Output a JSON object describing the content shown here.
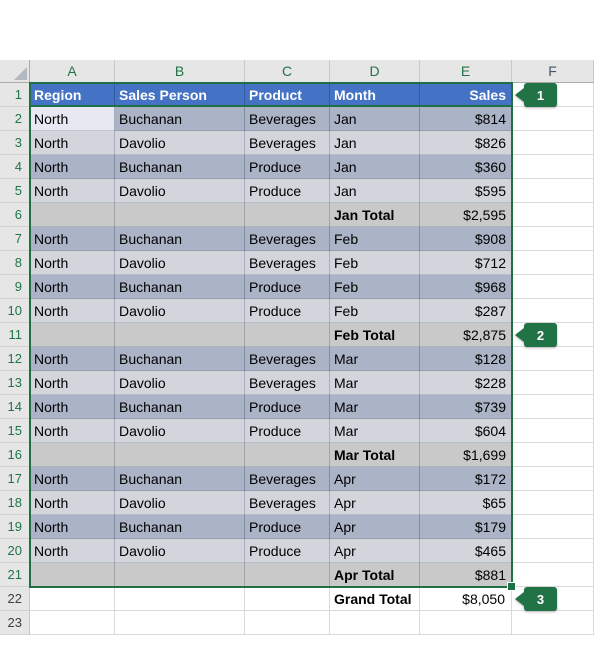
{
  "app": "excel-worksheet-subtotals",
  "column_letters": [
    "A",
    "B",
    "C",
    "D",
    "E",
    "F"
  ],
  "table": {
    "rows": [
      {
        "num": "1",
        "type": "header",
        "cells": [
          "Region",
          "Sales Person",
          "Product",
          "Month",
          "Sales"
        ]
      },
      {
        "num": "2",
        "type": "dark",
        "active": true,
        "cells": [
          "North",
          "Buchanan",
          "Beverages",
          "Jan",
          "$814"
        ]
      },
      {
        "num": "3",
        "type": "light",
        "cells": [
          "North",
          "Davolio",
          "Beverages",
          "Jan",
          "$826"
        ]
      },
      {
        "num": "4",
        "type": "dark",
        "cells": [
          "North",
          "Buchanan",
          "Produce",
          "Jan",
          "$360"
        ]
      },
      {
        "num": "5",
        "type": "light",
        "cells": [
          "North",
          "Davolio",
          "Produce",
          "Jan",
          "$595"
        ]
      },
      {
        "num": "6",
        "type": "subtotal",
        "cells": [
          "",
          "",
          "",
          "Jan Total",
          "$2,595"
        ]
      },
      {
        "num": "7",
        "type": "dark",
        "cells": [
          "North",
          "Buchanan",
          "Beverages",
          "Feb",
          "$908"
        ]
      },
      {
        "num": "8",
        "type": "light",
        "cells": [
          "North",
          "Davolio",
          "Beverages",
          "Feb",
          "$712"
        ]
      },
      {
        "num": "9",
        "type": "dark",
        "cells": [
          "North",
          "Buchanan",
          "Produce",
          "Feb",
          "$968"
        ]
      },
      {
        "num": "10",
        "type": "light",
        "cells": [
          "North",
          "Davolio",
          "Produce",
          "Feb",
          "$287"
        ]
      },
      {
        "num": "11",
        "type": "subtotal",
        "cells": [
          "",
          "",
          "",
          "Feb Total",
          "$2,875"
        ]
      },
      {
        "num": "12",
        "type": "dark",
        "cells": [
          "North",
          "Buchanan",
          "Beverages",
          "Mar",
          "$128"
        ]
      },
      {
        "num": "13",
        "type": "light",
        "cells": [
          "North",
          "Davolio",
          "Beverages",
          "Mar",
          "$228"
        ]
      },
      {
        "num": "14",
        "type": "dark",
        "cells": [
          "North",
          "Buchanan",
          "Produce",
          "Mar",
          "$739"
        ]
      },
      {
        "num": "15",
        "type": "light",
        "cells": [
          "North",
          "Davolio",
          "Produce",
          "Mar",
          "$604"
        ]
      },
      {
        "num": "16",
        "type": "subtotal",
        "cells": [
          "",
          "",
          "",
          "Mar Total",
          "$1,699"
        ]
      },
      {
        "num": "17",
        "type": "dark",
        "cells": [
          "North",
          "Buchanan",
          "Beverages",
          "Apr",
          "$172"
        ]
      },
      {
        "num": "18",
        "type": "light",
        "cells": [
          "North",
          "Davolio",
          "Beverages",
          "Apr",
          "$65"
        ]
      },
      {
        "num": "19",
        "type": "dark",
        "cells": [
          "North",
          "Buchanan",
          "Produce",
          "Apr",
          "$179"
        ]
      },
      {
        "num": "20",
        "type": "light",
        "cells": [
          "North",
          "Davolio",
          "Produce",
          "Apr",
          "$465"
        ]
      },
      {
        "num": "21",
        "type": "subtotal",
        "cells": [
          "",
          "",
          "",
          "Apr Total",
          "$881"
        ]
      },
      {
        "num": "22",
        "type": "grand",
        "cells": [
          "",
          "",
          "",
          "Grand Total",
          "$8,050"
        ]
      },
      {
        "num": "23",
        "type": "empty",
        "cells": [
          "",
          "",
          "",
          "",
          ""
        ]
      }
    ]
  },
  "badges": [
    {
      "label": "1"
    },
    {
      "label": "2"
    },
    {
      "label": "3"
    }
  ],
  "colors": {
    "header_fill": "#4472C4",
    "band_dark": "#ABB4C6",
    "band_light": "#D3D5DC",
    "subtotal_fill": "#C9C9C9",
    "active_cell_fill": "#E8E8F2",
    "selection_green": "#1F7145",
    "badge_green": "#217346",
    "gutter_fill": "#E6E6E6",
    "gridline": "#D9D9D9"
  }
}
